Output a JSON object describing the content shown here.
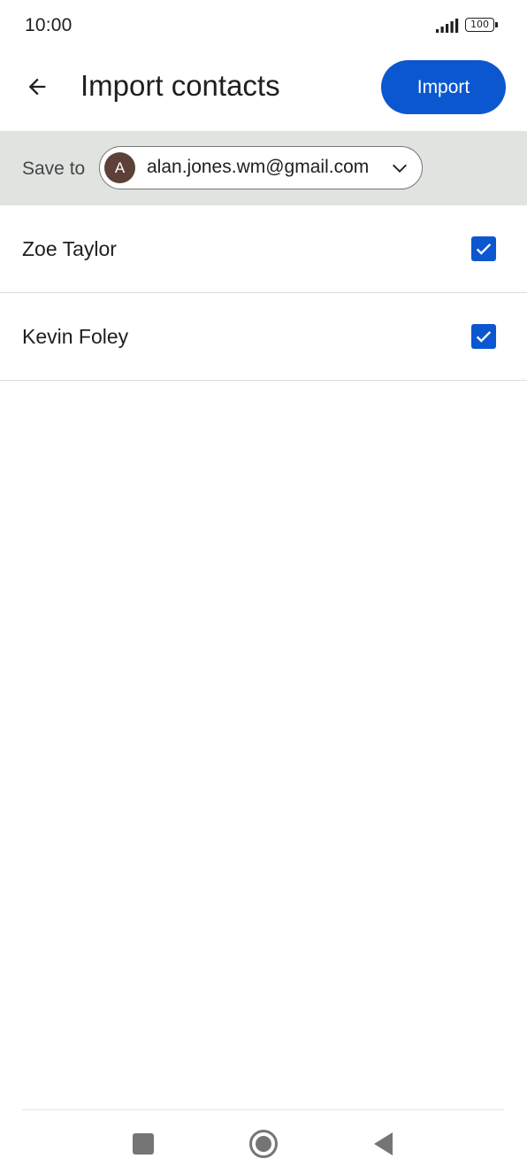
{
  "status_bar": {
    "time": "10:00",
    "battery_level": "100"
  },
  "app_bar": {
    "title": "Import contacts",
    "import_label": "Import"
  },
  "save_to": {
    "label": "Save to",
    "account_initial": "A",
    "account_email": "alan.jones.wm@gmail.com"
  },
  "contacts": [
    {
      "name": "Zoe Taylor",
      "checked": true
    },
    {
      "name": "Kevin Foley",
      "checked": true
    }
  ],
  "colors": {
    "accent": "#0b57d0",
    "save_bar_bg": "#e1e3e1",
    "avatar_bg": "#5d4037"
  },
  "icons": {
    "back": "arrow-back-icon",
    "chevron": "chevron-down-icon",
    "checkbox": "checkbox-checked-icon",
    "nav_recents": "square-icon",
    "nav_home": "circle-icon",
    "nav_back": "triangle-back-icon"
  }
}
